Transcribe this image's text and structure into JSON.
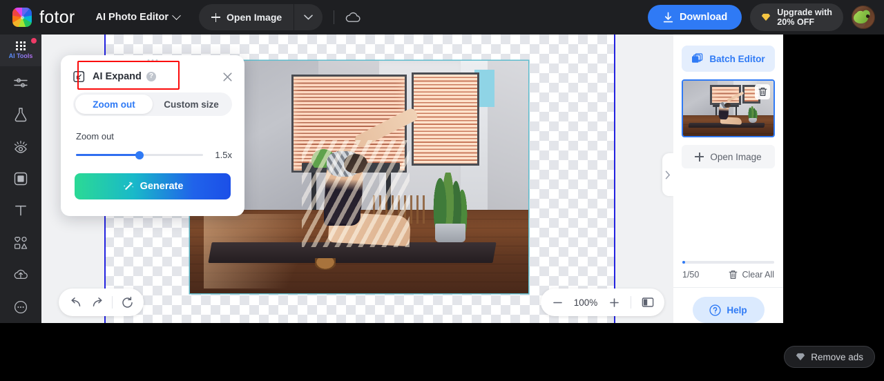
{
  "topbar": {
    "logo_text": "fotor",
    "mode_label": "AI Photo Editor",
    "open_image_label": "Open Image",
    "download_label": "Download",
    "upgrade_line1": "Upgrade with",
    "upgrade_line2": "20% OFF"
  },
  "rail": {
    "active_label": "AI Tools",
    "items": [
      {
        "icon": "ai-tools-grid-icon",
        "label": "AI Tools"
      },
      {
        "icon": "adjust-sliders-icon",
        "label": "Adjust"
      },
      {
        "icon": "flask-icon",
        "label": "Effects"
      },
      {
        "icon": "retouch-eye-icon",
        "label": "Retouch"
      },
      {
        "icon": "frame-icon",
        "label": "Frame"
      },
      {
        "icon": "text-icon",
        "label": "Text"
      },
      {
        "icon": "elements-icon",
        "label": "Elements"
      },
      {
        "icon": "cloud-upload-icon",
        "label": "Upload"
      },
      {
        "icon": "more-icon",
        "label": "More"
      }
    ]
  },
  "panel": {
    "title": "AI Expand",
    "help_glyph": "?",
    "tabs": [
      {
        "label": "Zoom out",
        "selected": true
      },
      {
        "label": "Custom size",
        "selected": false
      }
    ],
    "slider_label": "Zoom out",
    "slider_value": "1.5x",
    "slider_percent": 50,
    "generate_label": "Generate"
  },
  "canvas": {
    "zoom_level": "100%",
    "tools": [
      "undo-icon",
      "redo-icon",
      "reset-icon"
    ],
    "zoom_out_icon": "minus-icon",
    "zoom_in_icon": "plus-icon",
    "compare_icon": "compare-split-icon"
  },
  "rightpanel": {
    "batch_editor_label": "Batch Editor",
    "open_image_label": "Open Image",
    "count_label": "1/50",
    "clear_all_label": "Clear All",
    "help_label": "Help",
    "progress_percent": 2
  },
  "bottom": {
    "remove_ads_label": "Remove ads"
  },
  "colors": {
    "accent_blue": "#2f7af5",
    "panel_highlight_red": "#fb0a0a",
    "generate_gradient_start": "#2bd995",
    "generate_gradient_end": "#1b4fe8",
    "guide_blue": "#2323e0"
  }
}
